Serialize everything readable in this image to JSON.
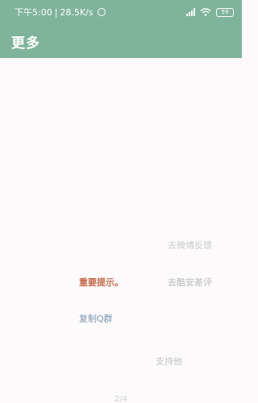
{
  "statusbar": {
    "time": "下午5:00",
    "separator": "|",
    "net_speed": "28.5K/s",
    "battery": "59"
  },
  "appbar": {
    "title": "更多"
  },
  "items": {
    "weibo_feedback": "去微博反馈",
    "kuan_review": "去酷安差评",
    "important_notice": "重要提示。",
    "copy_qq_group": "复制Q群",
    "support_author": "支持他"
  },
  "pager": {
    "indicator": "2/4"
  },
  "colors": {
    "accent": "#80b39c",
    "notice": "#c46a4a",
    "link": "#7a95b0"
  }
}
